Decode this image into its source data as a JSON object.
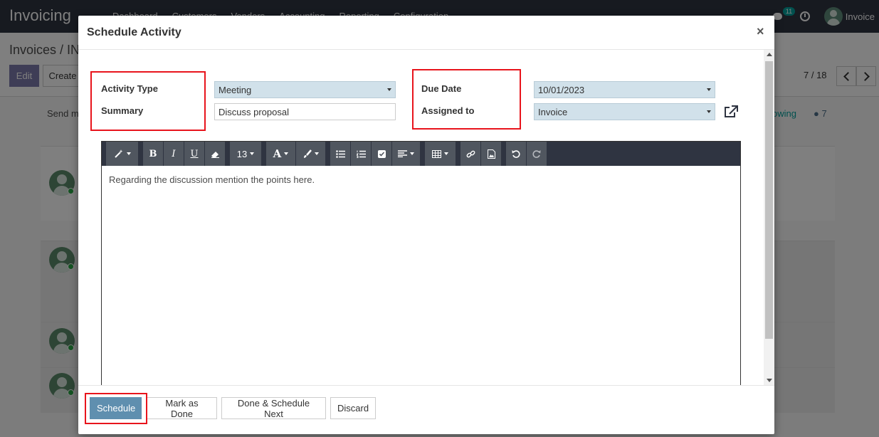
{
  "app": {
    "title": "Invoicing",
    "menu": [
      "Dashboard",
      "Customers",
      "Vendors",
      "Accounting",
      "Reporting",
      "Configuration"
    ],
    "chat_count": "11",
    "user_name": "Invoice"
  },
  "control_panel": {
    "breadcrumb": "Invoices / IN",
    "edit_label": "Edit",
    "create_label": "Create",
    "pager_value": "7 / 18"
  },
  "chatter": {
    "send_message": "Send m",
    "following": "owing",
    "followers_count": "7"
  },
  "dialog": {
    "title": "Schedule Activity",
    "close_label": "×",
    "fields": {
      "activity_type_label": "Activity Type",
      "activity_type_value": "Meeting",
      "summary_label": "Summary",
      "summary_value": "Discuss proposal",
      "due_date_label": "Due Date",
      "due_date_value": "10/01/2023",
      "assigned_to_label": "Assigned to",
      "assigned_to_value": "Invoice"
    },
    "editor": {
      "font_size": "13",
      "content": "Regarding the discussion mention the points here."
    },
    "buttons": {
      "schedule": "Schedule",
      "mark_done": "Mark as Done",
      "done_schedule_next": "Done & Schedule Next",
      "discard": "Discard"
    }
  },
  "colors": {
    "topbar": "#2f3441",
    "primary_button": "#5f8faf",
    "select_bg": "#d1e1ea",
    "highlight": "#e8141c"
  },
  "icons": [
    "chat-icon",
    "clock-icon",
    "close-icon",
    "external-link-icon",
    "magic-wand-icon",
    "bold-icon",
    "italic-icon",
    "underline-icon",
    "eraser-icon",
    "font-color-icon",
    "brush-icon",
    "bullet-list-icon",
    "numbered-list-icon",
    "checklist-icon",
    "align-icon",
    "table-icon",
    "link-icon",
    "image-icon",
    "undo-icon",
    "redo-icon"
  ]
}
